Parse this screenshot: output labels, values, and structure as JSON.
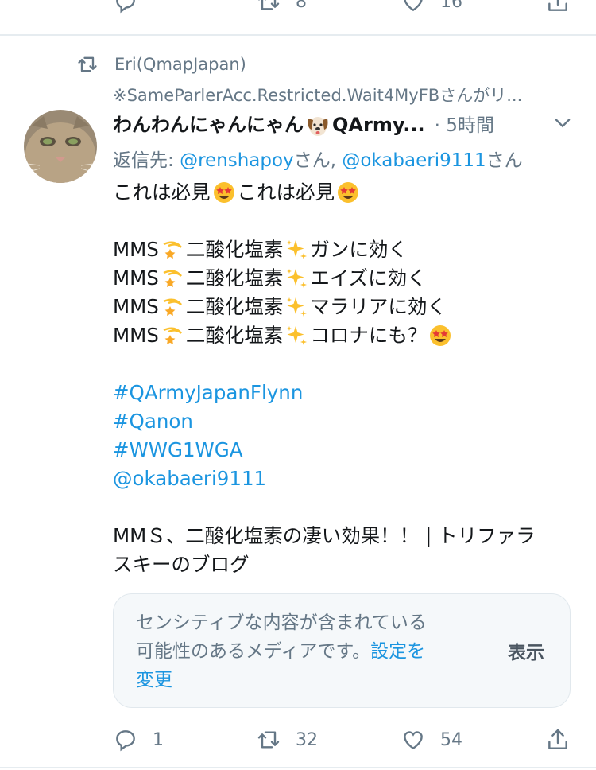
{
  "previous_tweet": {
    "actions": [
      {
        "icon": "reply-icon",
        "count": ""
      },
      {
        "icon": "retweet-icon",
        "count": "8"
      },
      {
        "icon": "like-icon",
        "count": "16"
      },
      {
        "icon": "share-icon",
        "count": ""
      }
    ]
  },
  "tweet": {
    "retweet_context": "Eri(QmapJapan)",
    "retweet_snippet": "※SameParlerAcc.Restricted.Wait4MyFBさんがリ...",
    "author": {
      "display_name_prefix": "わんわんにゃんにゃん",
      "display_name_suffix": "QArmy...",
      "separator": "·",
      "time": "5時間"
    },
    "reply_to": {
      "prefix": "返信先: ",
      "user1": "@renshapoy",
      "suffix1": "さん, ",
      "user2": "@okabaeri9111",
      "suffix2": "さん"
    },
    "body": {
      "line1_a": "これは必見",
      "line1_b": "これは必見",
      "mms": "MMS",
      "chem": "二酸化塩素",
      "claim1": "ガンに効く",
      "claim2": "エイズに効く",
      "claim3": "マラリアに効く",
      "claim4": "コロナにも？",
      "hashtags": [
        "#QArmyJapanFlynn",
        "#Qanon",
        "#WWG1WGA"
      ],
      "mention": "@okabaeri9111",
      "link_title_1": "MMＳ、二酸化塩素の凄い効果！！ | トリファラ",
      "link_title_2": "スキーのブログ"
    },
    "sensitive": {
      "line1": "センシティブな内容が含まれている",
      "line2": "可能性のあるメディアです。",
      "settings_link_1": "設定を",
      "settings_link_2": "変更",
      "show_label": "表示"
    },
    "actions": {
      "reply_count": "1",
      "retweet_count": "32",
      "like_count": "54"
    }
  },
  "colors": {
    "link": "#1b95e0",
    "secondary_text": "#657786",
    "primary_text": "#14171a",
    "divider": "#e6ecf0"
  }
}
